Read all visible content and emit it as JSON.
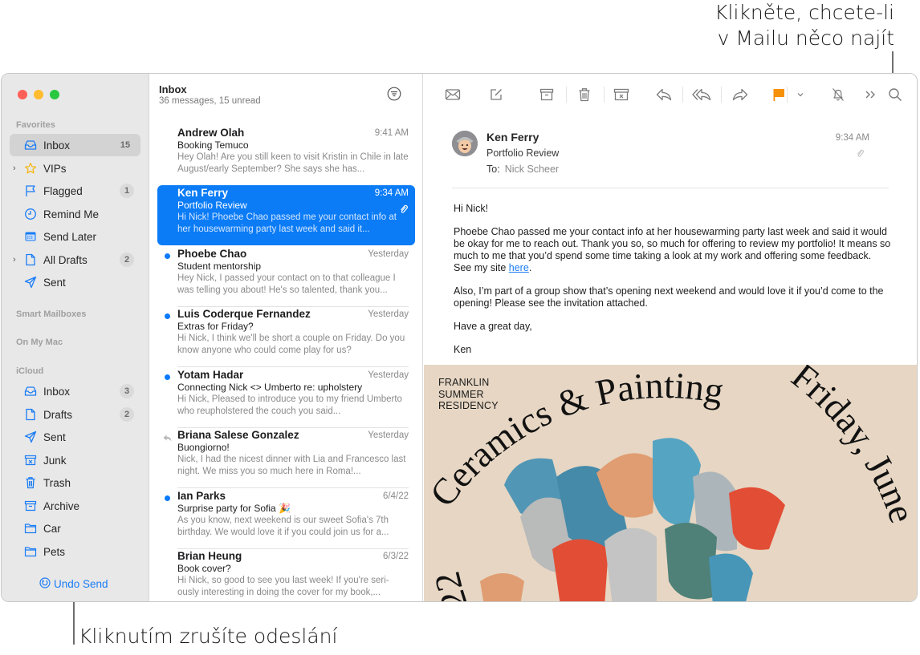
{
  "callouts": {
    "search": [
      "Klikněte, chcete-li",
      "v Mailu něco najít"
    ],
    "undo": "Kliknutím zrušíte odeslání"
  },
  "colors": {
    "accent": "#0b7cf6",
    "unread_dot": "#0a7aff",
    "flag": "#f7900a",
    "poster_bg": "#e6d6c3"
  },
  "sidebar": {
    "sections": {
      "favorites": "Favorites",
      "smart": "Smart Mailboxes",
      "on_my_mac": "On My Mac",
      "icloud": "iCloud"
    },
    "favorites": [
      {
        "label": "Inbox",
        "icon": "inbox-icon",
        "badge": "15",
        "selected": true
      },
      {
        "label": "VIPs",
        "icon": "star-icon",
        "badge": "",
        "expandable": true
      },
      {
        "label": "Flagged",
        "icon": "flag-icon",
        "badge": "1"
      },
      {
        "label": "Remind Me",
        "icon": "clock-icon",
        "badge": ""
      },
      {
        "label": "Send Later",
        "icon": "calendar-icon",
        "badge": ""
      },
      {
        "label": "All Drafts",
        "icon": "document-icon",
        "badge": "2",
        "expandable": true
      },
      {
        "label": "Sent",
        "icon": "paperplane-icon",
        "badge": ""
      }
    ],
    "icloud": [
      {
        "label": "Inbox",
        "icon": "inbox-icon",
        "badge": "3"
      },
      {
        "label": "Drafts",
        "icon": "document-icon",
        "badge": "2"
      },
      {
        "label": "Sent",
        "icon": "paperplane-icon",
        "badge": ""
      },
      {
        "label": "Junk",
        "icon": "junk-icon",
        "badge": ""
      },
      {
        "label": "Trash",
        "icon": "trash-icon",
        "badge": ""
      },
      {
        "label": "Archive",
        "icon": "archive-icon",
        "badge": ""
      },
      {
        "label": "Car",
        "icon": "folder-icon",
        "badge": ""
      },
      {
        "label": "Pets",
        "icon": "folder-icon",
        "badge": ""
      }
    ],
    "undo_send": "Undo Send"
  },
  "list": {
    "title": "Inbox",
    "subtitle": "36 messages, 15 unread",
    "messages": [
      {
        "from": "Andrew Olah",
        "date": "9:41 AM",
        "subject": "Booking Temuco",
        "preview": "Hey Olah! Are you still keen to visit Kristin in Chile in late August/early September? She says she has...",
        "unread": false,
        "replied": false,
        "attachment": false,
        "selected": false
      },
      {
        "from": "Ken Ferry",
        "date": "9:34 AM",
        "subject": "Portfolio Review",
        "preview": "Hi Nick! Phoebe Chao passed me your contact info at her housewarming party last week and said it...",
        "unread": false,
        "replied": false,
        "attachment": true,
        "selected": true
      },
      {
        "from": "Phoebe Chao",
        "date": "Yesterday",
        "subject": "Student mentorship",
        "preview": "Hey Nick, I passed your contact on to that colleague I was telling you about! He's so talented, thank you...",
        "unread": true,
        "replied": false,
        "attachment": false,
        "selected": false
      },
      {
        "from": "Luis Coderque Fernandez",
        "date": "Yesterday",
        "subject": "Extras for Friday?",
        "preview": "Hi Nick, I think we'll be short a couple on Friday. Do you know anyone who could come play for us?",
        "unread": true,
        "replied": false,
        "attachment": false,
        "selected": false
      },
      {
        "from": "Yotam Hadar",
        "date": "Yesterday",
        "subject": "Connecting Nick <> Umberto re: upholstery",
        "preview": "Hi Nick, Pleased to introduce you to my friend Umberto who reupholstered the couch you said...",
        "unread": true,
        "replied": false,
        "attachment": false,
        "selected": false
      },
      {
        "from": "Briana Salese Gonzalez",
        "date": "Yesterday",
        "subject": "Buongiorno!",
        "preview": "Nick, I had the nicest dinner with Lia and Francesco last night. We miss you so much here in Roma!...",
        "unread": false,
        "replied": true,
        "attachment": false,
        "selected": false
      },
      {
        "from": "Ian Parks",
        "date": "6/4/22",
        "subject": "Surprise party for Sofia 🎉",
        "preview": "As you know, next weekend is our sweet Sofia's 7th birthday. We would love it if you could join us for a...",
        "unread": true,
        "replied": false,
        "attachment": false,
        "selected": false
      },
      {
        "from": "Brian Heung",
        "date": "6/3/22",
        "subject": "Book cover?",
        "preview": "Hi Nick, so good to see you last week! If you're seri-ously interesting in doing the cover for my book,...",
        "unread": false,
        "replied": false,
        "attachment": false,
        "selected": false
      }
    ]
  },
  "toolbar": {
    "buttons": [
      "envelope-icon",
      "compose-icon",
      "archive-icon",
      "trash-icon",
      "junk-icon",
      "reply-icon",
      "reply-all-icon",
      "forward-icon",
      "flag-icon",
      "flag-menu-chevron-icon",
      "mute-bell-icon",
      "more-chevrons-icon",
      "search-icon"
    ]
  },
  "reader": {
    "from": "Ken Ferry",
    "subject": "Portfolio Review",
    "to_label": "To:",
    "to": "Nick Scheer",
    "time": "9:34 AM",
    "body": {
      "greeting": "Hi Nick!",
      "p1_before_link": "Phoebe Chao passed me your contact info at her housewarming party last week and said it would be okay for me to reach out. Thank you so, so much for offering to review my portfolio! It means so much to me that you’d spend some time taking a look at my work and offering some feedback. See my site ",
      "p1_link": "here",
      "p1_after_link": ".",
      "p2": "Also, I’m part of a group show that’s opening next weekend and would love it if you’d come to the opening! Please see the invitation attached.",
      "closing": "Have a great day,",
      "signature": "Ken"
    },
    "poster": {
      "label": [
        "FRANKLIN",
        "SUMMER",
        "RESIDENCY"
      ],
      "arc_title": "Ceramics & Painting",
      "arc_date": "Friday, June",
      "arc_year": "22"
    }
  }
}
